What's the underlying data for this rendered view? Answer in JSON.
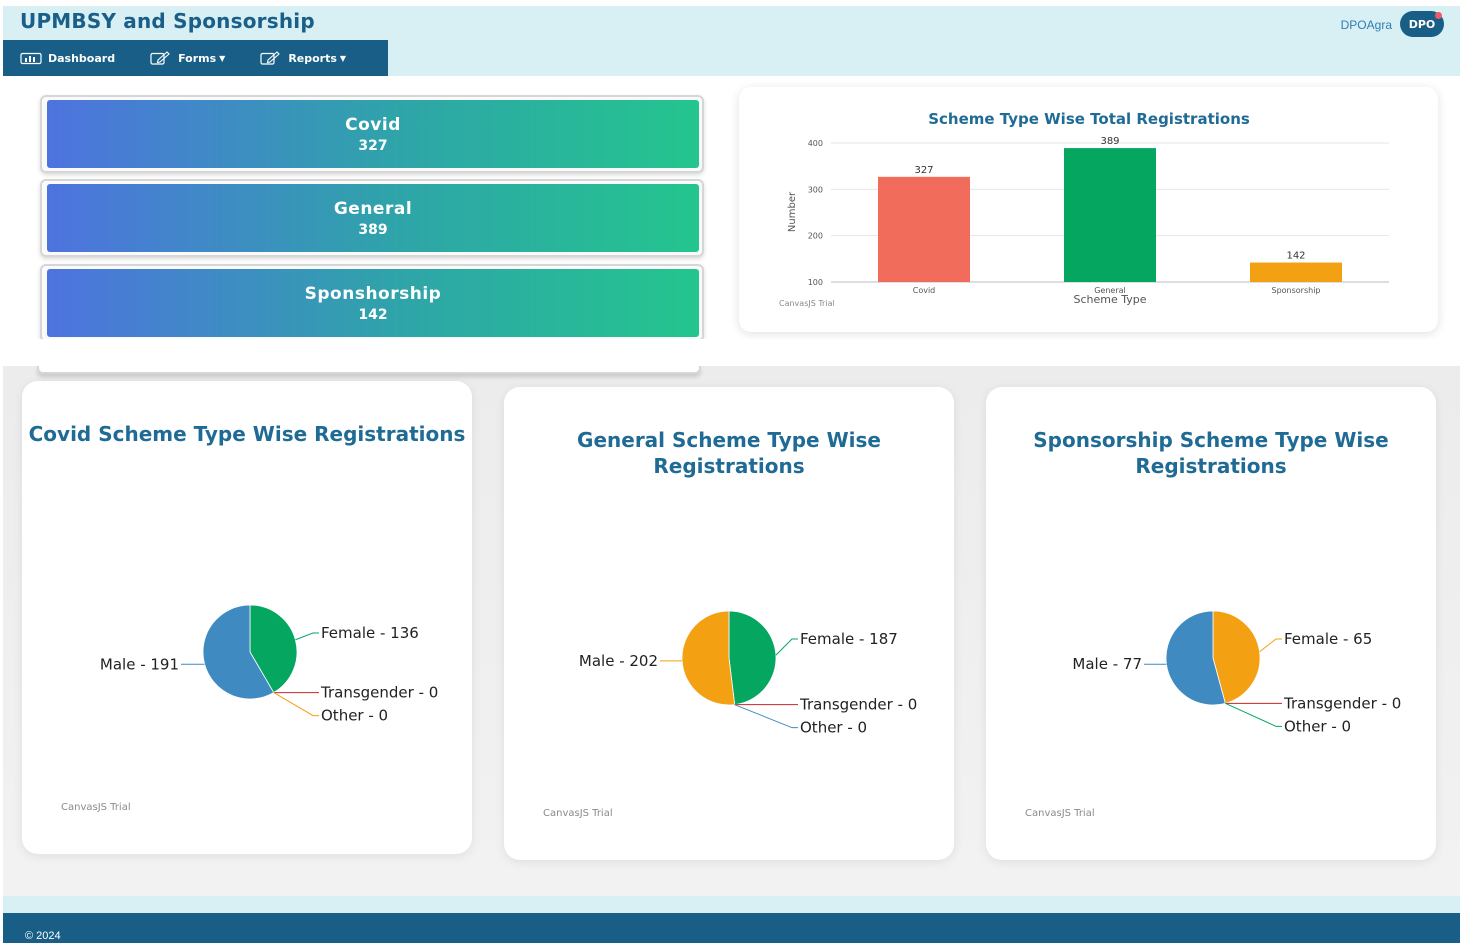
{
  "app": {
    "title": "UPMBSY and Sponsorship",
    "user": "DPOAgra",
    "avatar_text": "DPO"
  },
  "nav": {
    "dashboard": "Dashboard",
    "forms": "Forms",
    "reports": "Reports"
  },
  "stats": [
    {
      "label": "Covid",
      "value": "327"
    },
    {
      "label": "General",
      "value": "389"
    },
    {
      "label": "Sponshorship",
      "value": "142"
    }
  ],
  "bar_chart": {
    "credit": "CanvasJS Trial",
    "chart_data": {
      "type": "bar",
      "title": "Scheme Type Wise Total Registrations",
      "xlabel": "Scheme Type",
      "ylabel": "Number",
      "categories": [
        "Covid",
        "General",
        "Sponsorship"
      ],
      "values": [
        327,
        389,
        142
      ],
      "ylim": [
        100,
        400
      ],
      "yticks": [
        100,
        200,
        300,
        400
      ],
      "colors": [
        "#f26c5b",
        "#05a660",
        "#f3a013"
      ],
      "grid": true
    }
  },
  "pie_charts": [
    {
      "credit": "CanvasJS Trial",
      "chart_data": {
        "type": "pie",
        "title": "Covid Scheme Type Wise Registrations",
        "slices": [
          {
            "label": "Female",
            "value": 136,
            "color": "#05a660"
          },
          {
            "label": "Transgender",
            "value": 0,
            "color": "#c62828"
          },
          {
            "label": "Other",
            "value": 0,
            "color": "#f3a013"
          },
          {
            "label": "Male",
            "value": 191,
            "color": "#3f8ac0"
          }
        ]
      }
    },
    {
      "credit": "CanvasJS Trial",
      "chart_data": {
        "type": "pie",
        "title": "General Scheme Type Wise Registrations",
        "slices": [
          {
            "label": "Female",
            "value": 187,
            "color": "#05a660"
          },
          {
            "label": "Transgender",
            "value": 0,
            "color": "#c62828"
          },
          {
            "label": "Other",
            "value": 0,
            "color": "#3f8ac0"
          },
          {
            "label": "Male",
            "value": 202,
            "color": "#f3a013"
          }
        ]
      }
    },
    {
      "credit": "CanvasJS Trial",
      "chart_data": {
        "type": "pie",
        "title": "Sponsorship Scheme Type Wise Registrations",
        "slices": [
          {
            "label": "Female",
            "value": 65,
            "color": "#f3a013"
          },
          {
            "label": "Transgender",
            "value": 0,
            "color": "#c62828"
          },
          {
            "label": "Other",
            "value": 0,
            "color": "#05a660"
          },
          {
            "label": "Male",
            "value": 77,
            "color": "#3f8ac0"
          }
        ]
      }
    }
  ],
  "footer": {
    "text": "© 2024"
  }
}
